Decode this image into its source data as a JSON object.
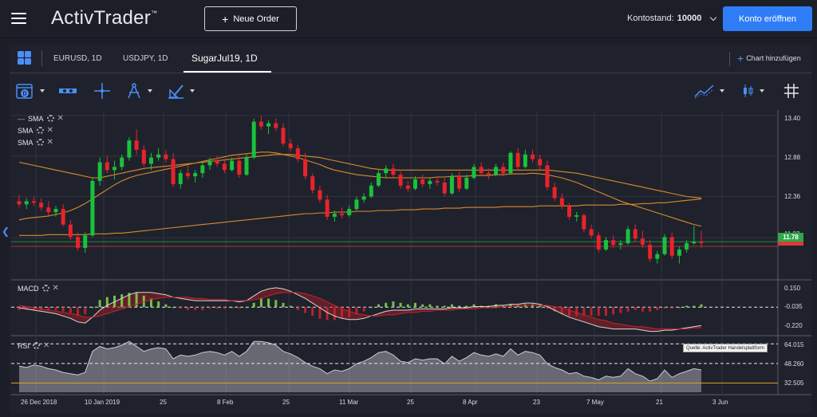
{
  "app": {
    "brand": "ActivTrader",
    "trademark": "™",
    "new_order_label": "Neue Order",
    "account_label": "Kontostand:",
    "account_value": "10000",
    "open_account_label": "Konto eröffnen"
  },
  "tabs": [
    {
      "label": "EURUSD, 1D",
      "active": false
    },
    {
      "label": "USDJPY, 1D",
      "active": false
    },
    {
      "label": "SugarJul19, 1D",
      "active": true
    }
  ],
  "add_chart_label": "Chart hinzufügen",
  "indicators": {
    "sma_labels": [
      "SMA",
      "SMA",
      "SMA"
    ],
    "macd_label": "MACD",
    "rsi_label": "RSI"
  },
  "price_axis": {
    "ticks": [
      "13.40",
      "12.88",
      "12.36",
      "11.83"
    ],
    "last_price": "11.78",
    "last_price_color": "#2ea84a",
    "second_tag_color": "#d93a3a"
  },
  "macd_axis": {
    "ticks": [
      "0.150",
      "-0.035",
      "-0.220"
    ]
  },
  "rsi_axis": {
    "ticks": [
      "64.015",
      "48.260",
      "32.505"
    ]
  },
  "source_note": "Quelle: ActivTrader Handelsplattform",
  "x_axis": {
    "labels": [
      "26 Dec 2018",
      "10 Jan 2019",
      "25",
      "8 Feb",
      "25",
      "11 Mar",
      "25",
      "8 Apr",
      "23",
      "7 May",
      "21",
      "3 Jun"
    ]
  },
  "colors": {
    "up": "#19c23c",
    "down": "#e8232b",
    "sma": "#d98a2b",
    "accent": "#2f7df6"
  },
  "chart_data": {
    "type": "candlestick",
    "instrument": "SugarJul19",
    "timeframe": "1D",
    "ylim": [
      11.3,
      13.45
    ],
    "candles": [
      [
        12.3,
        12.38,
        12.22,
        12.26
      ],
      [
        12.26,
        12.34,
        12.2,
        12.3
      ],
      [
        12.3,
        12.36,
        12.24,
        12.28
      ],
      [
        12.28,
        12.34,
        12.18,
        12.22
      ],
      [
        12.22,
        12.3,
        12.12,
        12.16
      ],
      [
        12.16,
        12.24,
        12.1,
        12.2
      ],
      [
        12.2,
        12.26,
        11.98,
        12.0
      ],
      [
        12.0,
        12.06,
        11.8,
        11.84
      ],
      [
        11.84,
        11.9,
        11.66,
        11.7
      ],
      [
        11.7,
        11.9,
        11.64,
        11.86
      ],
      [
        11.86,
        12.6,
        11.84,
        12.56
      ],
      [
        12.56,
        12.86,
        12.5,
        12.8
      ],
      [
        12.8,
        12.88,
        12.66,
        12.7
      ],
      [
        12.7,
        12.82,
        12.58,
        12.74
      ],
      [
        12.74,
        12.9,
        12.7,
        12.86
      ],
      [
        12.86,
        13.12,
        12.82,
        13.08
      ],
      [
        13.08,
        13.22,
        12.9,
        12.96
      ],
      [
        12.96,
        13.02,
        12.74,
        12.78
      ],
      [
        12.78,
        12.92,
        12.7,
        12.86
      ],
      [
        12.86,
        12.98,
        12.82,
        12.9
      ],
      [
        12.9,
        12.96,
        12.8,
        12.84
      ],
      [
        12.84,
        12.92,
        12.48,
        12.52
      ],
      [
        12.52,
        12.7,
        12.46,
        12.66
      ],
      [
        12.66,
        12.76,
        12.58,
        12.62
      ],
      [
        12.62,
        12.7,
        12.54,
        12.66
      ],
      [
        12.66,
        12.8,
        12.6,
        12.76
      ],
      [
        12.76,
        12.86,
        12.7,
        12.82
      ],
      [
        12.82,
        12.88,
        12.74,
        12.78
      ],
      [
        12.78,
        12.84,
        12.66,
        12.7
      ],
      [
        12.7,
        12.86,
        12.68,
        12.82
      ],
      [
        12.82,
        12.88,
        12.6,
        12.64
      ],
      [
        12.64,
        12.9,
        12.62,
        12.86
      ],
      [
        12.86,
        13.36,
        12.84,
        13.32
      ],
      [
        13.32,
        13.4,
        13.22,
        13.26
      ],
      [
        13.26,
        13.34,
        13.16,
        13.3
      ],
      [
        13.3,
        13.36,
        13.2,
        13.24
      ],
      [
        13.24,
        13.3,
        13.0,
        13.04
      ],
      [
        13.04,
        13.1,
        12.94,
        12.98
      ],
      [
        12.98,
        13.02,
        12.8,
        12.84
      ],
      [
        12.84,
        12.92,
        12.58,
        12.62
      ],
      [
        12.62,
        12.66,
        12.4,
        12.44
      ],
      [
        12.44,
        12.5,
        12.28,
        12.32
      ],
      [
        12.32,
        12.38,
        12.06,
        12.1
      ],
      [
        12.1,
        12.18,
        12.04,
        12.14
      ],
      [
        12.14,
        12.22,
        12.08,
        12.12
      ],
      [
        12.12,
        12.24,
        12.1,
        12.2
      ],
      [
        12.2,
        12.36,
        12.18,
        12.32
      ],
      [
        12.32,
        12.4,
        12.28,
        12.36
      ],
      [
        12.36,
        12.54,
        12.34,
        12.5
      ],
      [
        12.5,
        12.7,
        12.48,
        12.66
      ],
      [
        12.66,
        12.76,
        12.6,
        12.72
      ],
      [
        12.72,
        12.78,
        12.6,
        12.64
      ],
      [
        12.64,
        12.68,
        12.46,
        12.5
      ],
      [
        12.5,
        12.56,
        12.42,
        12.46
      ],
      [
        12.46,
        12.62,
        12.44,
        12.58
      ],
      [
        12.58,
        12.64,
        12.48,
        12.52
      ],
      [
        12.52,
        12.6,
        12.46,
        12.56
      ],
      [
        12.56,
        12.62,
        12.5,
        12.54
      ],
      [
        12.54,
        12.6,
        12.36,
        12.4
      ],
      [
        12.4,
        12.66,
        12.38,
        12.62
      ],
      [
        12.62,
        12.68,
        12.42,
        12.46
      ],
      [
        12.46,
        12.64,
        12.44,
        12.6
      ],
      [
        12.6,
        12.78,
        12.58,
        12.74
      ],
      [
        12.74,
        12.8,
        12.62,
        12.66
      ],
      [
        12.66,
        12.72,
        12.58,
        12.64
      ],
      [
        12.64,
        12.78,
        12.62,
        12.74
      ],
      [
        12.74,
        12.8,
        12.62,
        12.66
      ],
      [
        12.66,
        12.94,
        12.64,
        12.92
      ],
      [
        12.92,
        12.98,
        12.7,
        12.74
      ],
      [
        12.74,
        12.96,
        12.72,
        12.9
      ],
      [
        12.9,
        12.96,
        12.8,
        12.84
      ],
      [
        12.84,
        12.9,
        12.7,
        12.76
      ],
      [
        12.76,
        12.82,
        12.44,
        12.48
      ],
      [
        12.48,
        12.54,
        12.3,
        12.34
      ],
      [
        12.34,
        12.4,
        12.2,
        12.24
      ],
      [
        12.24,
        12.28,
        12.06,
        12.1
      ],
      [
        12.1,
        12.16,
        12.04,
        12.12
      ],
      [
        12.12,
        12.14,
        11.9,
        11.94
      ],
      [
        11.94,
        12.0,
        11.82,
        11.86
      ],
      [
        11.86,
        11.9,
        11.64,
        11.68
      ],
      [
        11.68,
        11.84,
        11.66,
        11.8
      ],
      [
        11.8,
        11.86,
        11.7,
        11.74
      ],
      [
        11.74,
        11.8,
        11.68,
        11.76
      ],
      [
        11.76,
        11.98,
        11.74,
        11.94
      ],
      [
        11.94,
        12.0,
        11.78,
        11.82
      ],
      [
        11.82,
        11.92,
        11.7,
        11.74
      ],
      [
        11.74,
        11.8,
        11.52,
        11.56
      ],
      [
        11.56,
        11.66,
        11.5,
        11.62
      ],
      [
        11.62,
        11.88,
        11.6,
        11.84
      ],
      [
        11.84,
        11.9,
        11.56,
        11.6
      ],
      [
        11.6,
        11.72,
        11.5,
        11.68
      ],
      [
        11.68,
        11.8,
        11.64,
        11.76
      ],
      [
        11.76,
        11.98,
        11.74,
        11.78
      ],
      [
        11.78,
        11.92,
        11.7,
        11.76
      ]
    ],
    "sma_short": [
      12.06,
      12.08,
      12.09,
      12.1,
      12.11,
      12.13,
      12.15,
      12.18,
      12.22,
      12.27,
      12.33,
      12.39,
      12.45,
      12.51,
      12.56,
      12.6,
      12.63,
      12.65,
      12.67,
      12.69,
      12.71,
      12.73,
      12.75,
      12.77,
      12.79,
      12.81,
      12.83,
      12.85,
      12.87,
      12.89,
      12.9,
      12.91,
      12.92,
      12.93,
      12.93,
      12.92,
      12.9,
      12.88,
      12.86,
      12.83,
      12.8,
      12.77,
      12.73,
      12.7,
      12.68,
      12.66,
      12.64,
      12.63,
      12.62,
      12.61,
      12.6,
      12.6,
      12.6,
      12.6,
      12.6,
      12.6,
      12.6,
      12.61,
      12.61,
      12.62,
      12.62,
      12.62,
      12.63,
      12.63,
      12.63,
      12.64,
      12.64,
      12.65,
      12.65,
      12.65,
      12.66,
      12.65,
      12.64,
      12.62,
      12.6,
      12.57,
      12.54,
      12.5,
      12.46,
      12.42,
      12.38,
      12.34,
      12.3,
      12.27,
      12.24,
      12.21,
      12.18,
      12.15,
      12.12,
      12.09,
      12.06,
      12.03,
      12.0,
      11.98
    ],
    "sma_mid": [
      12.8,
      12.78,
      12.76,
      12.74,
      12.72,
      12.7,
      12.68,
      12.66,
      12.64,
      12.62,
      12.6,
      12.6,
      12.62,
      12.64,
      12.66,
      12.68,
      12.7,
      12.72,
      12.73,
      12.74,
      12.75,
      12.76,
      12.77,
      12.78,
      12.79,
      12.8,
      12.81,
      12.82,
      12.83,
      12.84,
      12.85,
      12.86,
      12.87,
      12.88,
      12.89,
      12.9,
      12.9,
      12.9,
      12.89,
      12.88,
      12.87,
      12.86,
      12.84,
      12.82,
      12.8,
      12.78,
      12.76,
      12.74,
      12.72,
      12.71,
      12.7,
      12.7,
      12.7,
      12.7,
      12.7,
      12.7,
      12.7,
      12.7,
      12.7,
      12.7,
      12.7,
      12.7,
      12.7,
      12.7,
      12.7,
      12.7,
      12.7,
      12.7,
      12.7,
      12.7,
      12.7,
      12.7,
      12.7,
      12.69,
      12.68,
      12.67,
      12.66,
      12.64,
      12.62,
      12.6,
      12.58,
      12.56,
      12.54,
      12.52,
      12.5,
      12.48,
      12.46,
      12.44,
      12.42,
      12.4,
      12.38,
      12.36,
      12.35,
      12.34
    ],
    "sma_long": [
      11.86,
      11.86,
      11.86,
      11.86,
      11.87,
      11.87,
      11.87,
      11.87,
      11.87,
      11.87,
      11.88,
      11.88,
      11.88,
      11.89,
      11.89,
      11.9,
      11.91,
      11.92,
      11.93,
      11.94,
      11.95,
      11.96,
      11.97,
      11.98,
      11.99,
      12.0,
      12.01,
      12.02,
      12.03,
      12.04,
      12.05,
      12.06,
      12.07,
      12.08,
      12.09,
      12.1,
      12.11,
      12.12,
      12.13,
      12.14,
      12.14,
      12.15,
      12.15,
      12.16,
      12.16,
      12.16,
      12.17,
      12.17,
      12.17,
      12.18,
      12.18,
      12.18,
      12.19,
      12.19,
      12.19,
      12.2,
      12.2,
      12.2,
      12.21,
      12.21,
      12.21,
      12.22,
      12.22,
      12.22,
      12.22,
      12.22,
      12.23,
      12.23,
      12.23,
      12.23,
      12.23,
      12.24,
      12.24,
      12.24,
      12.24,
      12.24,
      12.24,
      12.25,
      12.25,
      12.25,
      12.25,
      12.25,
      12.26,
      12.26,
      12.26,
      12.27,
      12.27,
      12.28,
      12.28,
      12.29,
      12.3,
      12.31,
      12.32,
      12.33
    ],
    "macd_ylim": [
      -0.27,
      0.19
    ],
    "macd_line": [
      -0.04,
      -0.05,
      -0.06,
      -0.07,
      -0.08,
      -0.09,
      -0.11,
      -0.13,
      -0.16,
      -0.17,
      -0.12,
      -0.06,
      -0.02,
      0.01,
      0.04,
      0.07,
      0.09,
      0.09,
      0.09,
      0.08,
      0.07,
      0.05,
      0.04,
      0.03,
      0.02,
      0.02,
      0.02,
      0.02,
      0.02,
      0.02,
      0.01,
      0.02,
      0.06,
      0.1,
      0.12,
      0.13,
      0.12,
      0.1,
      0.07,
      0.04,
      0.0,
      -0.04,
      -0.08,
      -0.11,
      -0.13,
      -0.14,
      -0.14,
      -0.13,
      -0.11,
      -0.09,
      -0.07,
      -0.06,
      -0.06,
      -0.06,
      -0.05,
      -0.05,
      -0.05,
      -0.05,
      -0.05,
      -0.04,
      -0.04,
      -0.04,
      -0.03,
      -0.03,
      -0.03,
      -0.02,
      -0.02,
      -0.01,
      -0.01,
      0.0,
      0.0,
      -0.01,
      -0.03,
      -0.06,
      -0.09,
      -0.12,
      -0.14,
      -0.16,
      -0.18,
      -0.2,
      -0.21,
      -0.22,
      -0.22,
      -0.22,
      -0.22,
      -0.23,
      -0.24,
      -0.24,
      -0.23,
      -0.23,
      -0.22,
      -0.21,
      -0.2,
      -0.19
    ],
    "macd_signal": [
      -0.02,
      -0.03,
      -0.04,
      -0.05,
      -0.06,
      -0.07,
      -0.08,
      -0.09,
      -0.1,
      -0.12,
      -0.12,
      -0.11,
      -0.09,
      -0.07,
      -0.05,
      -0.03,
      -0.01,
      0.01,
      0.03,
      0.04,
      0.05,
      0.05,
      0.05,
      0.05,
      0.04,
      0.04,
      0.03,
      0.03,
      0.03,
      0.02,
      0.02,
      0.02,
      0.03,
      0.04,
      0.06,
      0.08,
      0.09,
      0.09,
      0.09,
      0.08,
      0.06,
      0.04,
      0.01,
      -0.02,
      -0.05,
      -0.07,
      -0.09,
      -0.1,
      -0.11,
      -0.11,
      -0.1,
      -0.1,
      -0.09,
      -0.08,
      -0.08,
      -0.07,
      -0.07,
      -0.06,
      -0.06,
      -0.06,
      -0.05,
      -0.05,
      -0.05,
      -0.04,
      -0.04,
      -0.04,
      -0.03,
      -0.03,
      -0.02,
      -0.02,
      -0.02,
      -0.02,
      -0.02,
      -0.03,
      -0.04,
      -0.06,
      -0.08,
      -0.1,
      -0.12,
      -0.14,
      -0.15,
      -0.17,
      -0.18,
      -0.19,
      -0.2,
      -0.2,
      -0.21,
      -0.22,
      -0.22,
      -0.22,
      -0.22,
      -0.22,
      -0.21,
      -0.21
    ],
    "rsi_ylim": [
      25,
      70
    ],
    "rsi": [
      46,
      45,
      47,
      46,
      44,
      43,
      41,
      40,
      39,
      41,
      58,
      62,
      60,
      61,
      63,
      66,
      62,
      58,
      60,
      61,
      60,
      52,
      55,
      54,
      55,
      57,
      58,
      57,
      55,
      58,
      54,
      58,
      66,
      66,
      65,
      63,
      58,
      56,
      53,
      49,
      46,
      44,
      40,
      43,
      42,
      44,
      48,
      50,
      53,
      57,
      58,
      55,
      50,
      49,
      52,
      51,
      52,
      52,
      48,
      54,
      50,
      53,
      57,
      55,
      54,
      56,
      54,
      60,
      55,
      58,
      57,
      55,
      48,
      45,
      43,
      40,
      41,
      38,
      37,
      35,
      38,
      37,
      38,
      44,
      40,
      38,
      34,
      36,
      43,
      37,
      40,
      42,
      44,
      43
    ],
    "rsi_levels": [
      30,
      50,
      70
    ]
  }
}
